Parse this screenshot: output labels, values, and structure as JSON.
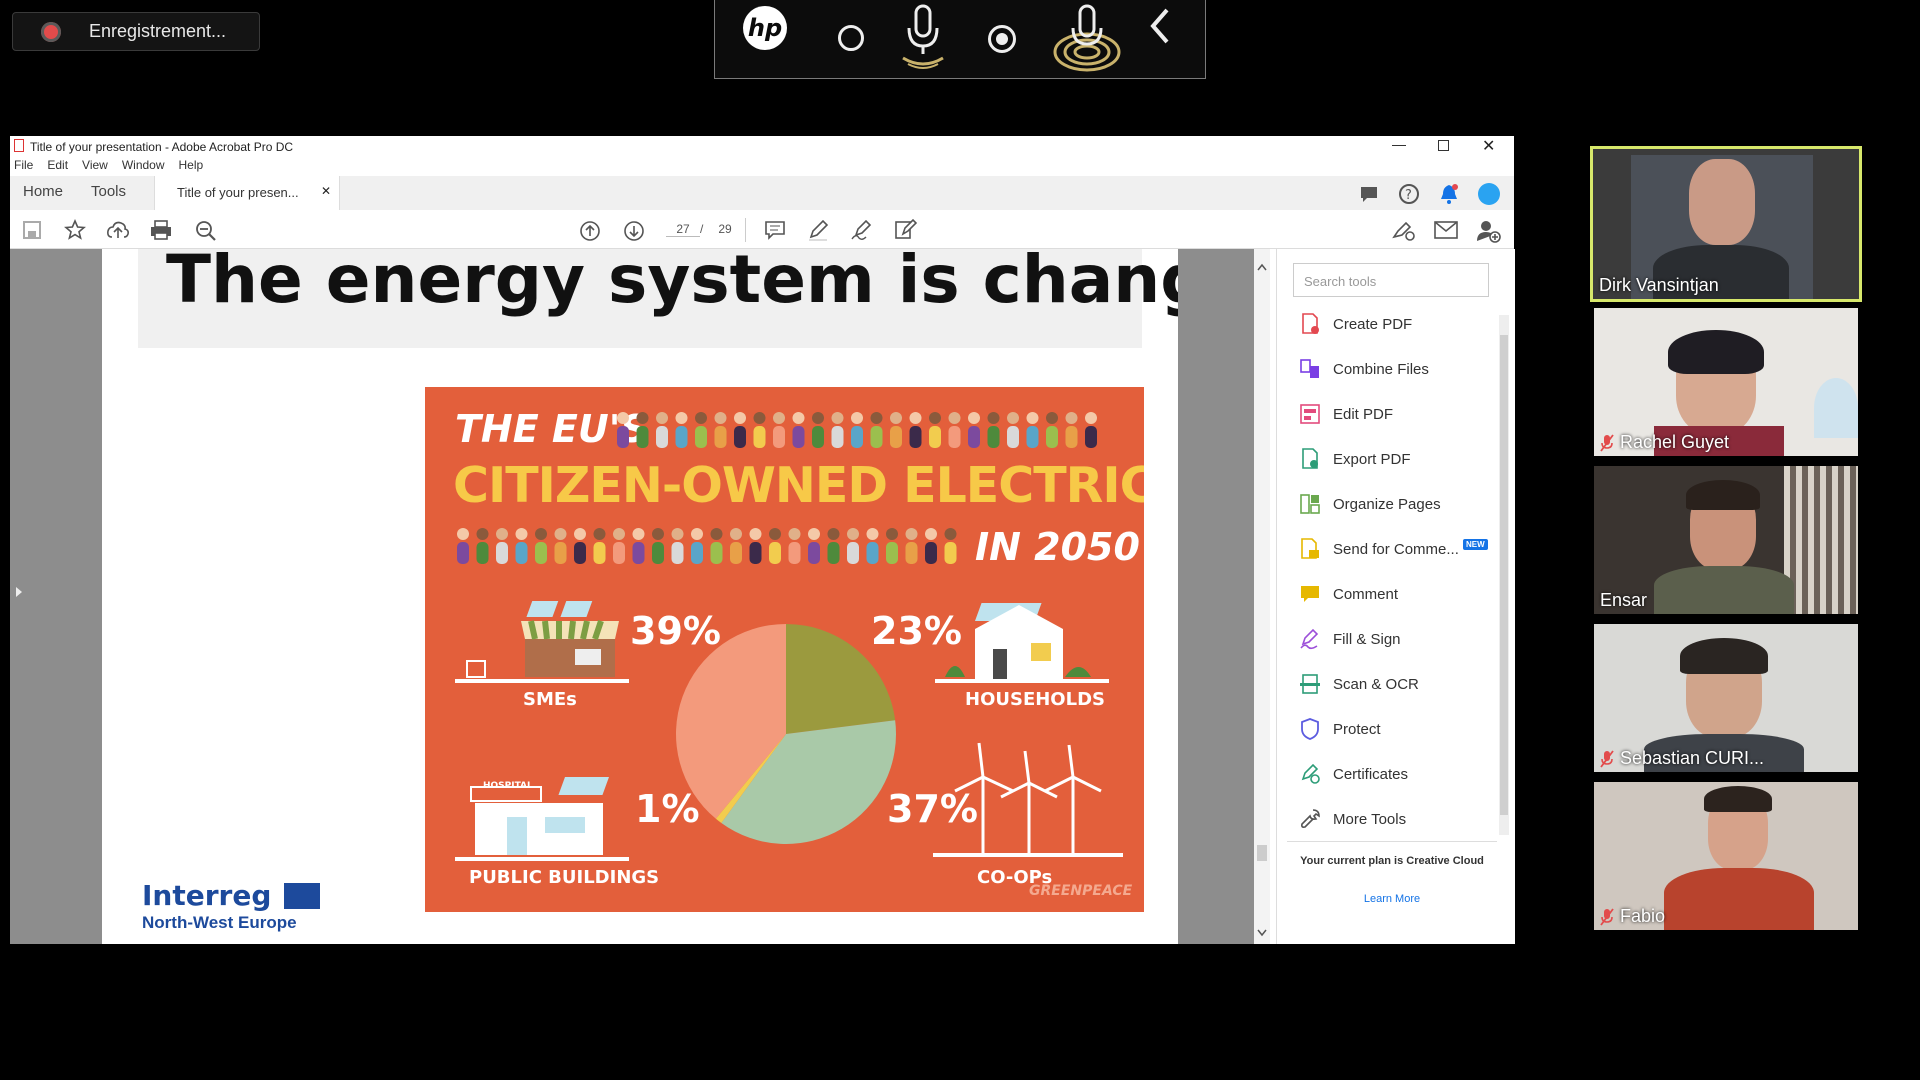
{
  "recording": {
    "label": "Enregistrement..."
  },
  "hp_toolbar": {
    "logo": "hp",
    "icons": [
      "circle-icon",
      "microphone-icon",
      "record-icon",
      "microphone-active-icon",
      "chevron-left-icon"
    ]
  },
  "window": {
    "title": "Title of your presentation - Adobe Acrobat Pro DC",
    "menu": [
      "File",
      "Edit",
      "View",
      "Window",
      "Help"
    ],
    "tabs": {
      "home": "Home",
      "tools": "Tools",
      "doc": "Title of your presen..."
    },
    "page": {
      "current": "27",
      "separator": "/",
      "total": "29"
    }
  },
  "slide": {
    "title": "The energy system is changing",
    "poster": {
      "line1": "THE EU'S",
      "line2": "CITIZEN-OWNED ELECTRICITY",
      "line3": "IN 2050",
      "labels": {
        "smes": "SMEs",
        "households": "HOUSEHOLDS",
        "public": "PUBLIC BUILDINGS",
        "coops": "CO-OPs"
      },
      "pct": {
        "smes": "39%",
        "households": "23%",
        "public": "1%",
        "coops": "37%"
      },
      "hospital": "HOSPITAL",
      "credit": "GREENPEACE"
    },
    "logo": {
      "name": "Interreg",
      "sub": "North-West Europe"
    }
  },
  "chart_data": {
    "type": "pie",
    "categories": [
      "SMEs",
      "HOUSEHOLDS",
      "CO-OPs",
      "PUBLIC BUILDINGS"
    ],
    "values": [
      39,
      23,
      37,
      1
    ],
    "colors": [
      "#f39a7c",
      "#9b9a3e",
      "#a9c9a8",
      "#f2cc4e"
    ]
  },
  "right_pane": {
    "search_placeholder": "Search tools",
    "tools": [
      "Create PDF",
      "Combine Files",
      "Edit PDF",
      "Export PDF",
      "Organize Pages",
      "Send for Comme...",
      "Comment",
      "Fill & Sign",
      "Scan & OCR",
      "Protect",
      "Certificates",
      "More Tools"
    ],
    "new_badge": "NEW",
    "plan_text": "Your current plan is Creative Cloud",
    "learn_more": "Learn More"
  },
  "participants": [
    {
      "name": "Dirk Vansintjan",
      "muted": false,
      "active": true
    },
    {
      "name": "Rachel Guyet",
      "muted": true,
      "active": false
    },
    {
      "name": "Ensar",
      "muted": false,
      "active": false
    },
    {
      "name": "Sebastian CURI...",
      "muted": true,
      "active": false
    },
    {
      "name": "Fabio",
      "muted": true,
      "active": false
    }
  ]
}
